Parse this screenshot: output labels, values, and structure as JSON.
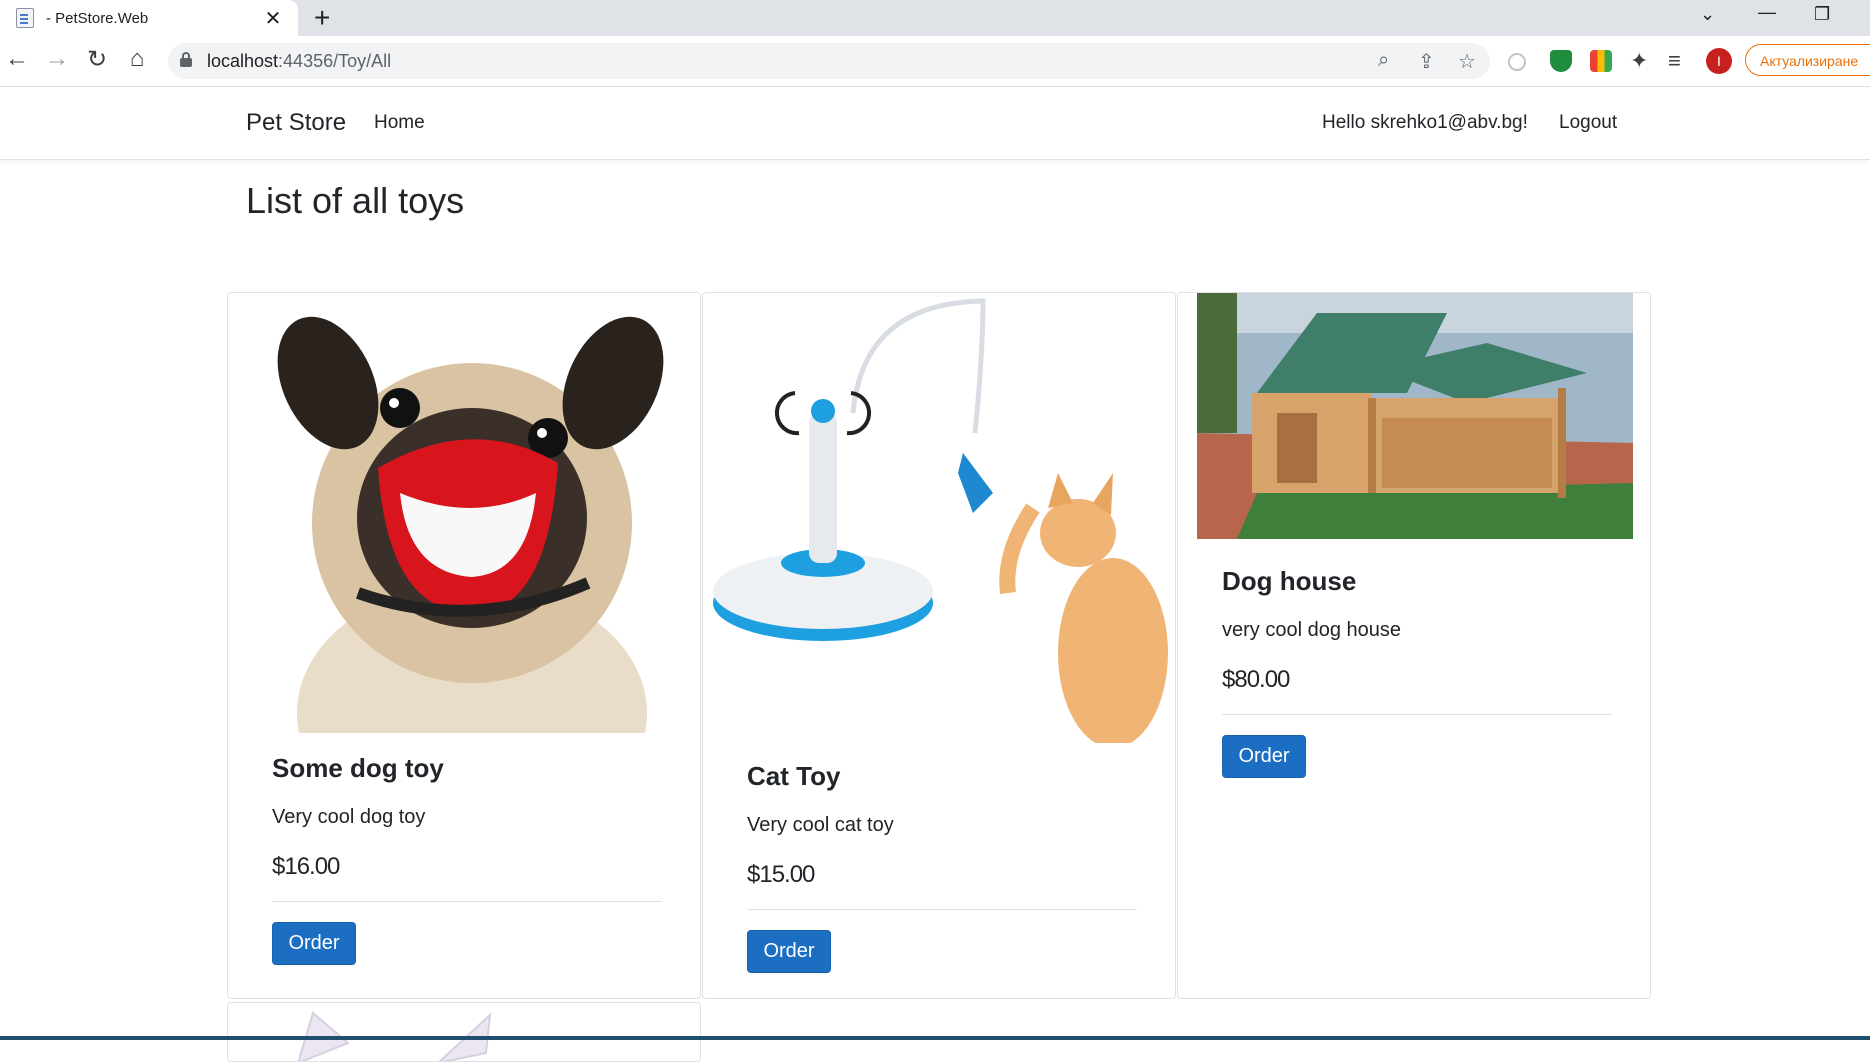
{
  "browser": {
    "tab_title": "- PetStore.Web",
    "url_host": "localhost",
    "url_path": ":44356/Toy/All",
    "update_button": "Актуализиране",
    "profile_initial": "I"
  },
  "navbar": {
    "brand": "Pet Store",
    "home": "Home",
    "greeting": "Hello skrehko1@abv.bg!",
    "logout": "Logout"
  },
  "main": {
    "title": "List of all toys",
    "cards": [
      {
        "name": "Some dog toy",
        "description": "Very cool dog toy",
        "price": "$16.00",
        "order_label": "Order"
      },
      {
        "name": "Cat Toy",
        "description": "Very cool cat toy",
        "price": "$15.00",
        "order_label": "Order"
      },
      {
        "name": "Dog house",
        "description": "very cool dog house",
        "price": "$80.00",
        "order_label": "Order"
      }
    ]
  },
  "colors": {
    "primary_button": "#1b6ec2",
    "update_button": "#e8710a"
  }
}
